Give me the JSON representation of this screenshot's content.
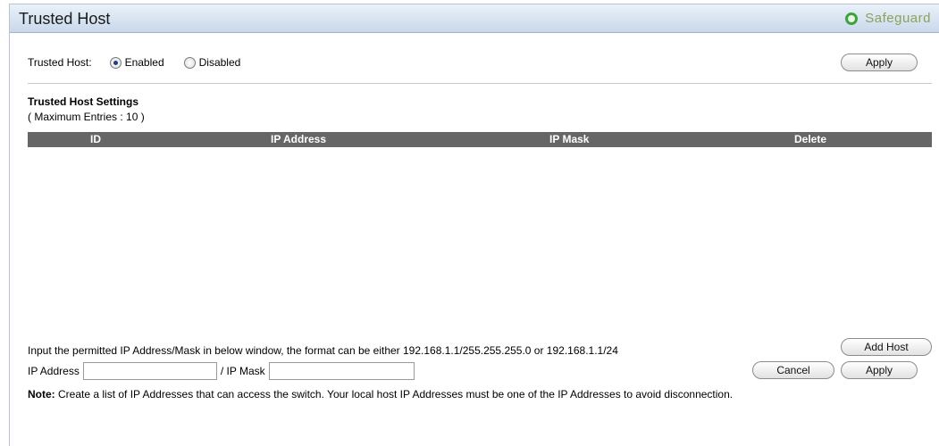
{
  "header": {
    "title": "Trusted Host",
    "safeguard_label": "Safeguard",
    "safeguard_color": "#39a53a"
  },
  "status": {
    "label": "Trusted Host:",
    "options": [
      {
        "label": "Enabled",
        "selected": true
      },
      {
        "label": "Disabled",
        "selected": false
      }
    ],
    "apply_label": "Apply"
  },
  "settings": {
    "title": "Trusted Host Settings",
    "max_entries": "( Maximum Entries : 10 )",
    "columns": [
      "ID",
      "IP Address",
      "IP Mask",
      "Delete"
    ],
    "rows": []
  },
  "form": {
    "hint": "Input the permitted IP Address/Mask in below window, the format can be either 192.168.1.1/255.255.255.0 or 192.168.1.1/24",
    "ip_label": "IP Address",
    "ip_value": "",
    "mask_label": "/ IP Mask",
    "mask_value": "",
    "add_host_label": "Add Host",
    "cancel_label": "Cancel",
    "apply_label": "Apply"
  },
  "note": {
    "bold": "Note:",
    "text": " Create a list of IP Addresses that can access the switch. Your local host IP Addresses must be one of the IP Addresses to avoid disconnection."
  }
}
